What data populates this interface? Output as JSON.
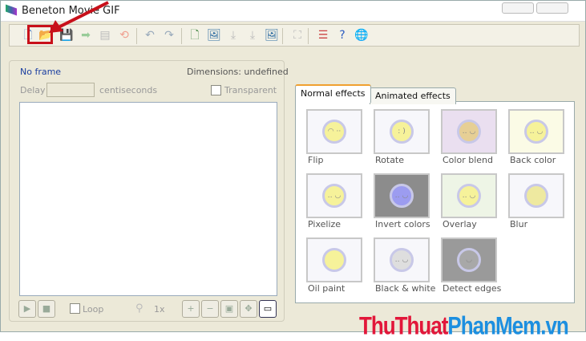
{
  "window": {
    "title": "Beneton Movie GIF"
  },
  "toolbar": {
    "icons": [
      "new-icon",
      "open-icon",
      "save-icon",
      "export-icon",
      "save-numbered-icon",
      "refresh-icon",
      "undo-icon",
      "redo-icon",
      "add-frame-icon",
      "insert-image-icon",
      "import-icon",
      "import-frames-icon",
      "numbered-images-icon",
      "resize-icon",
      "frame-list-icon",
      "help-icon",
      "web-icon"
    ]
  },
  "frame": {
    "status": "No frame",
    "dimensions": "Dimensions: undefined",
    "delay_label": "Delay",
    "delay_value": "",
    "delay_unit": "centiseconds",
    "transparent_label": "Transparent"
  },
  "player": {
    "loop_label": "Loop",
    "zoom_level": "1x"
  },
  "tabs": [
    {
      "label": "Normal effects",
      "active": true
    },
    {
      "label": "Animated effects",
      "active": false
    }
  ],
  "effects": [
    {
      "label": "Flip",
      "bg": "#f7f7fb",
      "face": "#f6f29a",
      "glyph": "◠ ··"
    },
    {
      "label": "Rotate",
      "bg": "#f7f7fb",
      "face": "#f6f29a",
      "glyph": ": )"
    },
    {
      "label": "Color blend",
      "bg": "#eadff0",
      "face": "#e6cf95",
      "glyph": "‥ ◡"
    },
    {
      "label": "Back color",
      "bg": "#fbfbe6",
      "face": "#f6f29a",
      "glyph": "‥ ◡"
    },
    {
      "label": "Pixelize",
      "bg": "#f7f7fb",
      "face": "#f6f29a",
      "glyph": "‥ ◡"
    },
    {
      "label": "Invert colors",
      "bg": "#8c8c8c",
      "face": "#9c9cf0",
      "glyph": "‥ ◡"
    },
    {
      "label": "Overlay",
      "bg": "#eef5e6",
      "face": "#f6f29a",
      "glyph": "‥ ◡"
    },
    {
      "label": "Blur",
      "bg": "#f7f7fb",
      "face": "#eee9a0",
      "glyph": ""
    },
    {
      "label": "Oil paint",
      "bg": "#f7f7fb",
      "face": "#f6f29a",
      "glyph": ""
    },
    {
      "label": "Black & white",
      "bg": "#f7f7fb",
      "face": "#dedede",
      "glyph": "‥ ◡"
    },
    {
      "label": "Detect edges",
      "bg": "#9a9a9a",
      "face": "#a8a8a8",
      "glyph": "◡"
    }
  ],
  "watermark": {
    "part1": "ThuThuat",
    "part2": "PhanMem.vn",
    "color1": "#e2173a",
    "color2": "#1c8fe0"
  }
}
